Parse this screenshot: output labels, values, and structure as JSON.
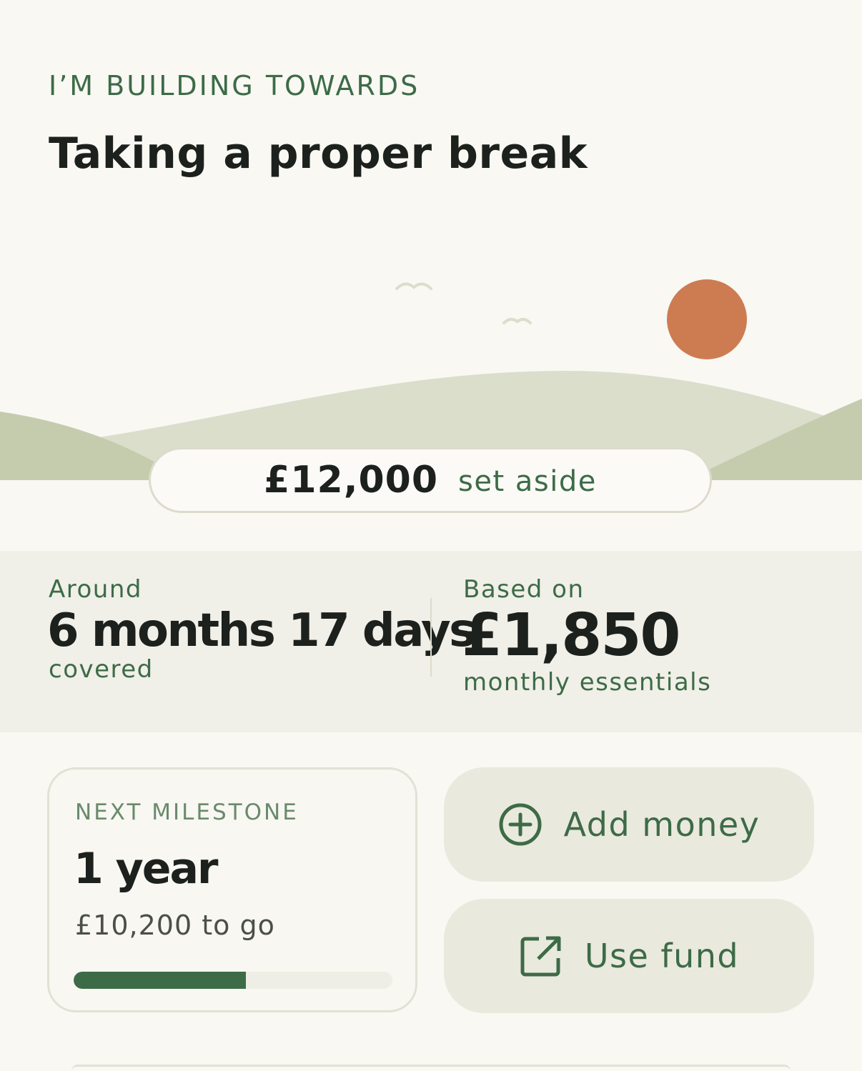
{
  "header": {
    "eyebrow": "I’M BUILDING TOWARDS",
    "title": "Taking a proper break"
  },
  "illustration": {
    "icons": [
      "bird-icon",
      "bird-icon",
      "sun-icon",
      "hills"
    ],
    "colors": {
      "sun": "#cd7c52",
      "hill_back": "#dadecb",
      "hill_front": "#c5ccae",
      "bird": "#dadecb"
    }
  },
  "balance": {
    "amount": "£12,000",
    "label": "set aside"
  },
  "coverage": {
    "prefix": "Around",
    "value": "6 months 17 days",
    "suffix": "covered"
  },
  "essentials": {
    "prefix": "Based on",
    "value": "£1,850",
    "suffix": "monthly essentials"
  },
  "milestone": {
    "label": "NEXT MILESTONE",
    "value": "1 year",
    "remaining": "£10,200 to go",
    "progress_fraction": 0.54
  },
  "actions": {
    "add_money": {
      "label": "Add money",
      "icon": "plus-circle-icon"
    },
    "use_fund": {
      "label": "Use fund",
      "icon": "external-link-icon"
    }
  },
  "colors": {
    "accent": "#3d6b47",
    "background": "#f9f8f3",
    "stats_background": "#f0efe8",
    "button_background": "#eae9dd"
  }
}
